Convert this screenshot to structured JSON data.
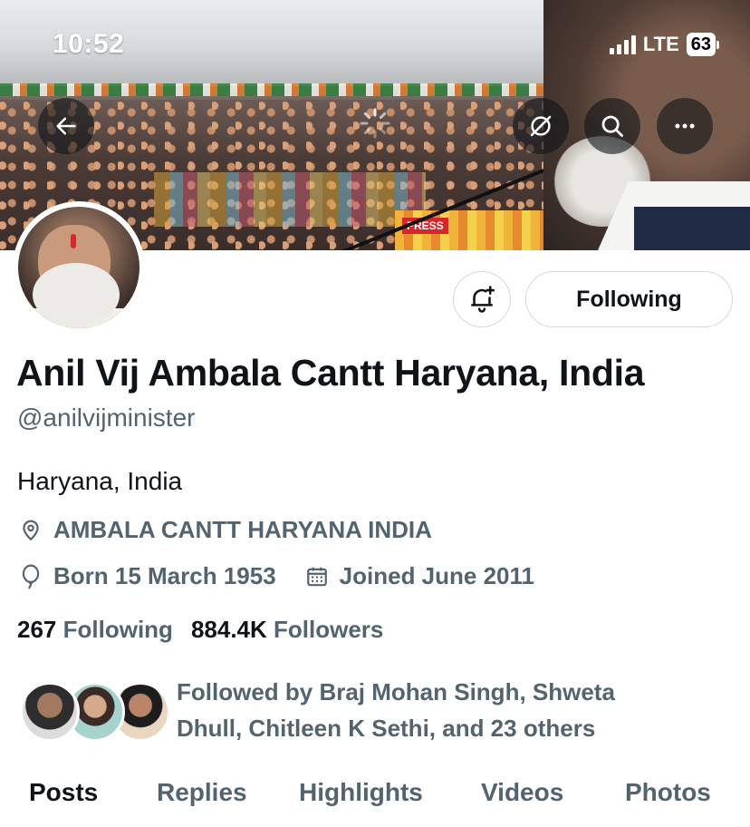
{
  "status_bar": {
    "time": "10:52",
    "network": "LTE",
    "battery": "63"
  },
  "banner": {
    "press_label": "PRESS"
  },
  "actions": {
    "following_label": "Following"
  },
  "profile": {
    "display_name": "Anil Vij Ambala Cantt Haryana, India",
    "handle": "@anilvijminister",
    "bio": "Haryana, India",
    "location": "AMBALA CANTT HARYANA INDIA",
    "born": "Born 15 March 1953",
    "joined": "Joined June 2011",
    "following_count": "267",
    "following_label": "Following",
    "followers_count": "884.4K",
    "followers_label": "Followers",
    "followed_by_line1": "Followed by Braj Mohan Singh, Shweta",
    "followed_by_line2": "Dhull, Chitleen K Sethi, and 23 others"
  },
  "tabs": [
    {
      "label": "Posts",
      "active": true
    },
    {
      "label": "Replies",
      "active": false
    },
    {
      "label": "Highlights",
      "active": false
    },
    {
      "label": "Videos",
      "active": false
    },
    {
      "label": "Photos",
      "active": false
    }
  ],
  "colors": {
    "text_primary": "#0f1419",
    "text_secondary": "#536471",
    "border": "#cfd9de"
  }
}
